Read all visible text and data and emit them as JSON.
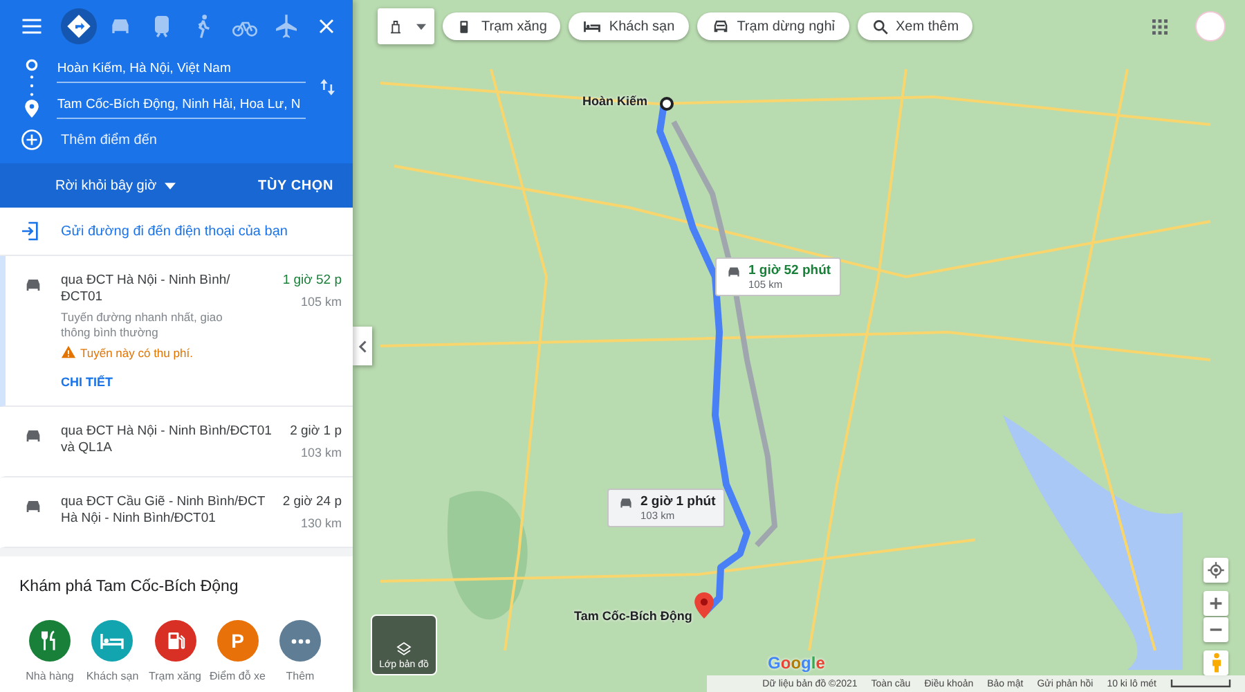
{
  "modes": [
    {
      "kind": "best",
      "selected": true
    },
    {
      "kind": "car",
      "selected": false
    },
    {
      "kind": "transit",
      "selected": false
    },
    {
      "kind": "walk",
      "selected": false
    },
    {
      "kind": "bike",
      "selected": false
    },
    {
      "kind": "plane",
      "selected": false
    }
  ],
  "origin": {
    "value": "Hoàn Kiếm, Hà Nội, Việt Nam"
  },
  "destination": {
    "value": "Tam Cốc-Bích Động, Ninh Hải, Hoa Lư, N"
  },
  "add_destination": "Thêm điểm đến",
  "depart": "Rời khỏi bây giờ",
  "options": "TÙY CHỌN",
  "send_to_phone": "Gửi đường đi đến điện thoại của bạn",
  "routes": [
    {
      "selected": true,
      "via": "qua ĐCT Hà Nội - Ninh Bình/ĐCT01",
      "duration": "1 giờ 52 p",
      "distance": "105 km",
      "note": "Tuyến đường nhanh nhất, giao thông bình thường",
      "warning": "Tuyến này có thu phí.",
      "details": "CHI TIẾT"
    },
    {
      "selected": false,
      "via": "qua ĐCT Hà Nội - Ninh Bình/ĐCT01 và QL1A",
      "duration": "2 giờ 1 p",
      "distance": "103 km"
    },
    {
      "selected": false,
      "via": "qua ĐCT Cầu Giẽ - Ninh Bình/ĐCT Hà Nội - Ninh Bình/ĐCT01",
      "duration": "2 giờ 24 p",
      "distance": "130 km"
    }
  ],
  "explore": {
    "title": "Khám phá Tam Cốc-Bích Động",
    "items": [
      {
        "kind": "restaurant",
        "label": "Nhà hàng",
        "color": "#188038"
      },
      {
        "kind": "hotel",
        "label": "Khách sạn",
        "color": "#12a4af"
      },
      {
        "kind": "gas",
        "label": "Trạm xăng",
        "color": "#d93025"
      },
      {
        "kind": "parking",
        "label": "Điểm đỗ xe",
        "color": "#e8710a",
        "glyph": "P"
      },
      {
        "kind": "more",
        "label": "Thêm",
        "color": "#5f7d95"
      }
    ]
  },
  "map": {
    "chips": [
      {
        "kind": "gas",
        "label": "Trạm xăng"
      },
      {
        "kind": "hotel",
        "label": "Khách sạn"
      },
      {
        "kind": "rest",
        "label": "Trạm dừng nghỉ"
      },
      {
        "kind": "search",
        "label": "Xem thêm"
      }
    ],
    "callouts": [
      {
        "selected": true,
        "duration": "1 giờ 52 phút",
        "distance": "105 km"
      },
      {
        "selected": false,
        "duration": "2 giờ 1 phút",
        "distance": "103 km"
      }
    ],
    "origin_label": "Hoàn Kiếm",
    "destination_label": "Tam Cốc-Bích Động",
    "layers_label": "Lớp bản đồ",
    "logo": "Google",
    "footer": [
      "Dữ liệu bản đồ ©2021",
      "Toàn cầu",
      "Điều khoản",
      "Bảo mật",
      "Gửi phản hồi"
    ],
    "scale": "10 ki lô mét"
  }
}
